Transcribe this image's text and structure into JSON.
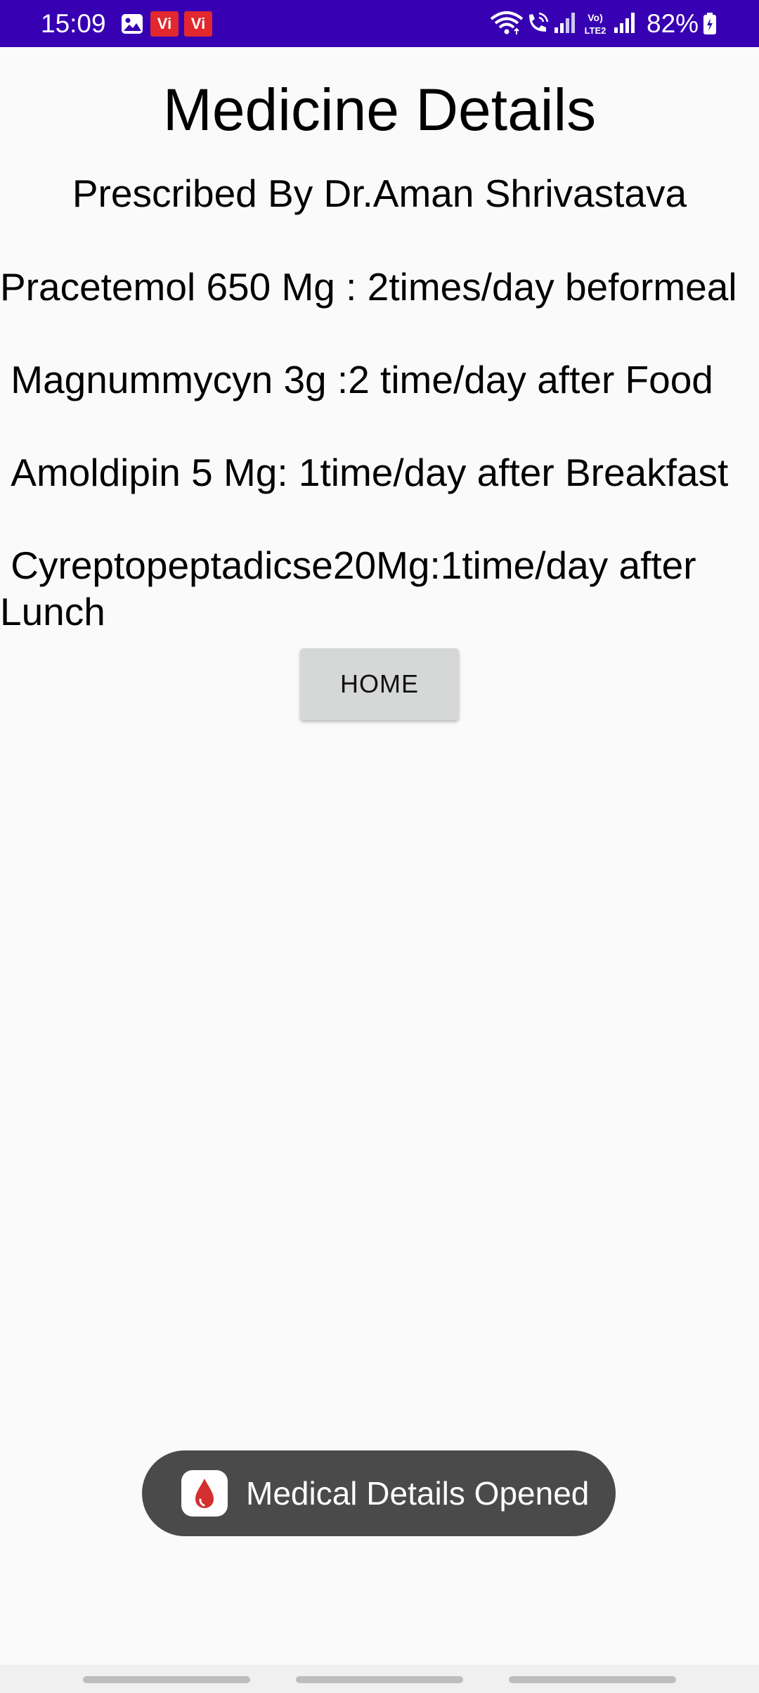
{
  "colors": {
    "status_bar": "#3700b3",
    "background": "#fafafa",
    "button": "#d6d7d7",
    "toast": "#4a4a4a",
    "carrier_badge": "#e0282e",
    "drop_red": "#d32f2f"
  },
  "status_bar": {
    "time": "15:09",
    "carrier_badges": [
      "Vi",
      "Vi"
    ],
    "battery": "82%",
    "icons": [
      "gallery-icon",
      "wifi-icon",
      "call-icon",
      "signal-icon",
      "volte-lte2-icon",
      "signal-icon",
      "battery-charging-icon"
    ]
  },
  "page": {
    "title": "Medicine Details",
    "prescribed_by": "Prescribed By Dr.Aman Shrivastava",
    "medicines": [
      "Pracetemol 650 Mg : 2times/day beformeal",
      " Magnummycyn 3g :2 time/day after Food",
      " Amoldipin 5 Mg: 1time/day after Breakfast",
      " Cyreptopeptadicse20Mg:1time/day after Lunch"
    ],
    "home_button": "HOME"
  },
  "toast": {
    "icon": "blood-drop-icon",
    "text": "Medical Details Opened"
  },
  "nav_bar": {
    "items": [
      "recents-handle",
      "home-handle",
      "back-handle"
    ]
  }
}
